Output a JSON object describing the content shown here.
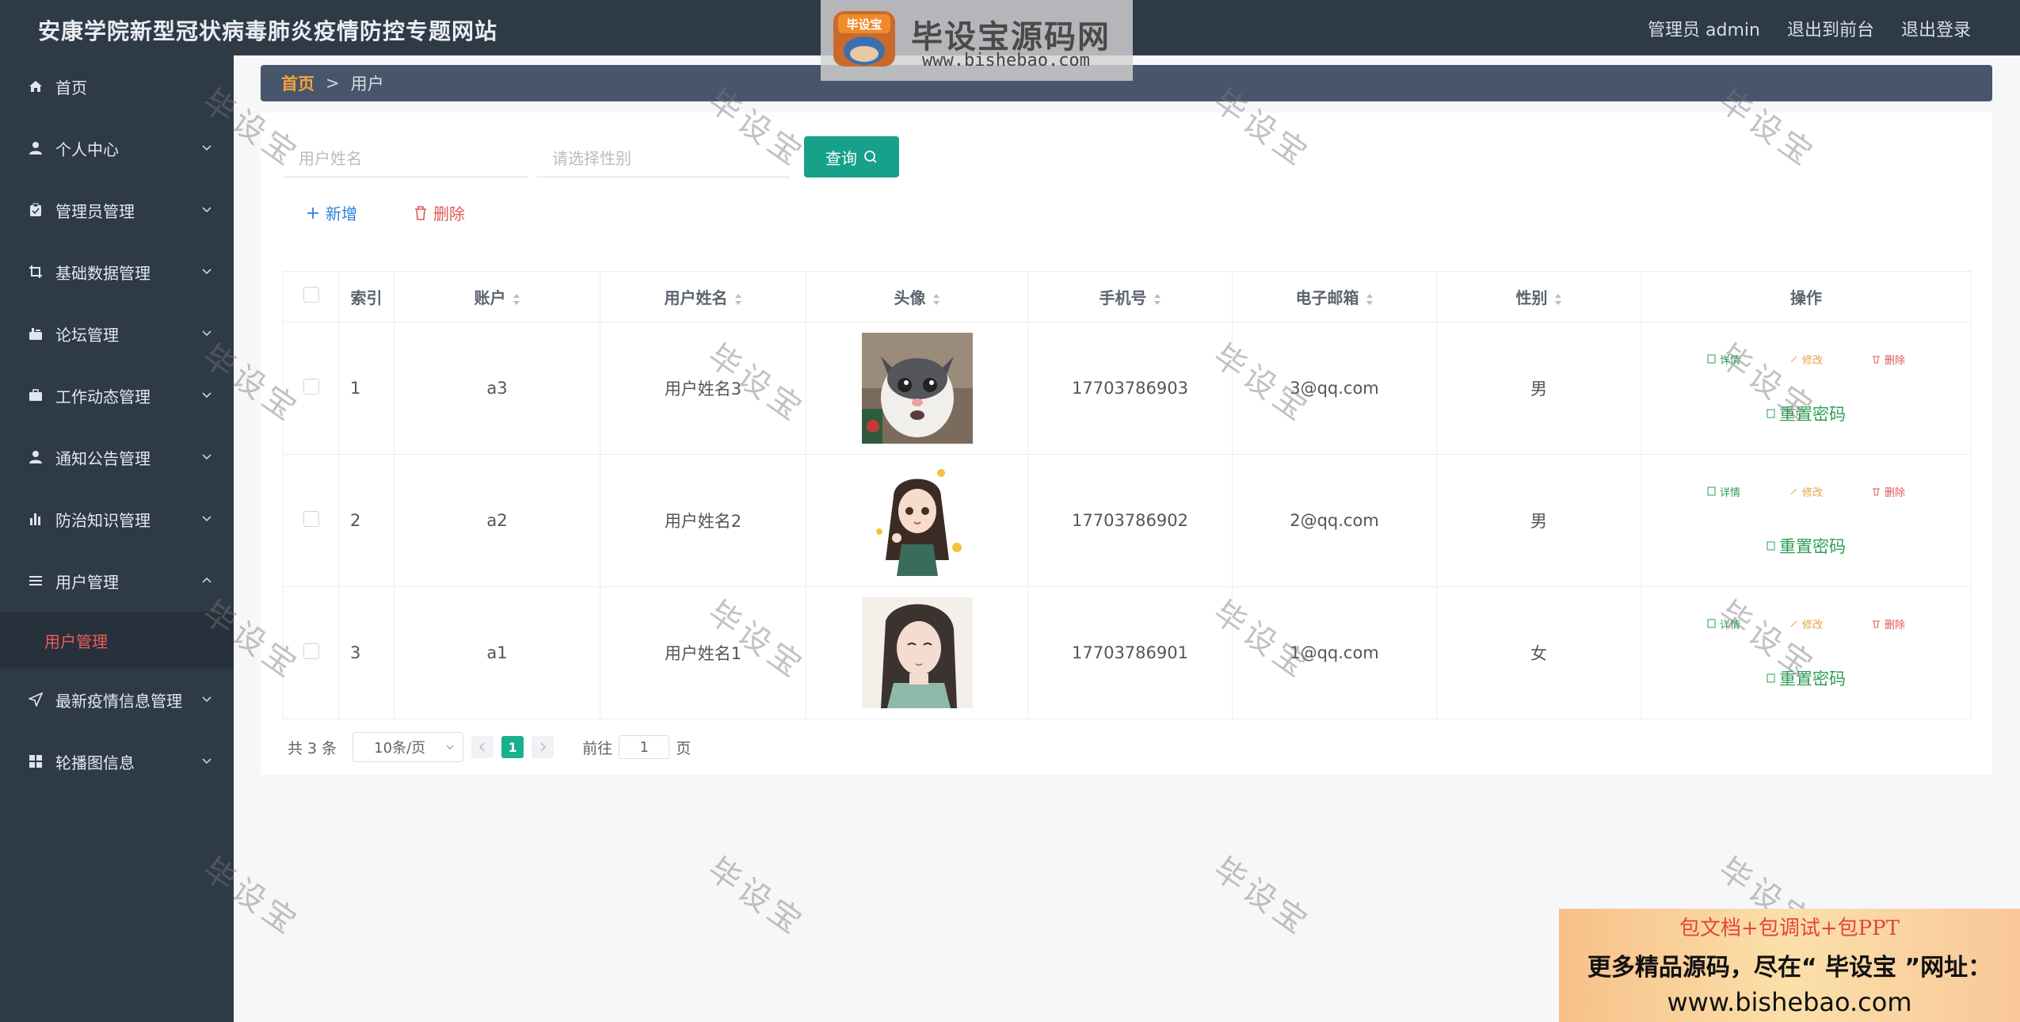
{
  "header": {
    "site_title": "安康学院新型冠状病毒肺炎疫情防控专题网站",
    "admin_label": "管理员 admin",
    "to_front": "退出到前台",
    "logout": "退出登录"
  },
  "sidebar": {
    "items": [
      {
        "label": "首页",
        "icon": "home-icon"
      },
      {
        "label": "个人中心",
        "icon": "user-icon"
      },
      {
        "label": "管理员管理",
        "icon": "clipboard-icon"
      },
      {
        "label": "基础数据管理",
        "icon": "crop-icon"
      },
      {
        "label": "论坛管理",
        "icon": "forum-icon"
      },
      {
        "label": "工作动态管理",
        "icon": "briefcase-icon"
      },
      {
        "label": "通知公告管理",
        "icon": "user-icon"
      },
      {
        "label": "防治知识管理",
        "icon": "bar-chart-icon"
      },
      {
        "label": "用户管理",
        "icon": "list-icon"
      },
      {
        "label": "最新疫情信息管理",
        "icon": "send-icon"
      },
      {
        "label": "轮播图信息",
        "icon": "grid-icon"
      }
    ],
    "active_sub": "用户管理"
  },
  "breadcrumb": {
    "home": "首页",
    "separator": ">",
    "current": "用户"
  },
  "search": {
    "name_placeholder": "用户姓名",
    "gender_placeholder": "请选择性别",
    "query_label": "查询"
  },
  "actions": {
    "add_label": "新增",
    "delete_label": "删除"
  },
  "table": {
    "headers": [
      "索引",
      "账户",
      "用户姓名",
      "头像",
      "手机号",
      "电子邮箱",
      "性别",
      "操作"
    ],
    "rows": [
      {
        "index": "1",
        "account": "a3",
        "name": "用户姓名3",
        "avatar": "cat-photo",
        "phone": "17703786903",
        "email": "3@qq.com",
        "gender": "男"
      },
      {
        "index": "2",
        "account": "a2",
        "name": "用户姓名2",
        "avatar": "anime-girl-illustration",
        "phone": "17703786902",
        "email": "2@qq.com",
        "gender": "男"
      },
      {
        "index": "3",
        "account": "a1",
        "name": "用户姓名1",
        "avatar": "anime-girl-portrait",
        "phone": "17703786901",
        "email": "1@qq.com",
        "gender": "女"
      }
    ],
    "ops": {
      "detail": "详情",
      "edit": "修改",
      "delete": "删除",
      "reset": "重置密码"
    }
  },
  "pagination": {
    "total": "共 3 条",
    "page_size": "10条/页",
    "current_page": "1",
    "goto_prefix": "前往",
    "goto_value": "1",
    "goto_suffix": "页"
  },
  "watermark": {
    "logo_badge": "毕设宝",
    "brand": "毕设宝源码网",
    "url": "www.bishebao.com",
    "diagonal_text": "毕设宝"
  },
  "ad": {
    "line1": "包文档+包调试+包PPT",
    "line2": "更多精品源码，尽在“ 毕设宝 ”网址：",
    "line3": "www.bishebao.com"
  },
  "colors": {
    "sidebar_bg": "#2f3a47",
    "accent_green": "#17a08a",
    "active_red": "#f05b5b",
    "breadcrumb_home": "#f2a53a"
  }
}
